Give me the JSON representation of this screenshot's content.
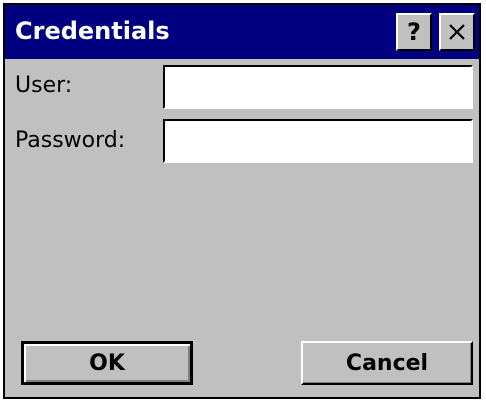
{
  "window": {
    "title": "Credentials",
    "help_label": "?",
    "close_icon": "close-icon"
  },
  "form": {
    "user_label": "User:",
    "user_value": "",
    "password_label": "Password:",
    "password_value": ""
  },
  "buttons": {
    "ok_label": "OK",
    "cancel_label": "Cancel"
  },
  "colors": {
    "titlebar": "#000080",
    "face": "#c0c0c0",
    "field": "#ffffff"
  }
}
